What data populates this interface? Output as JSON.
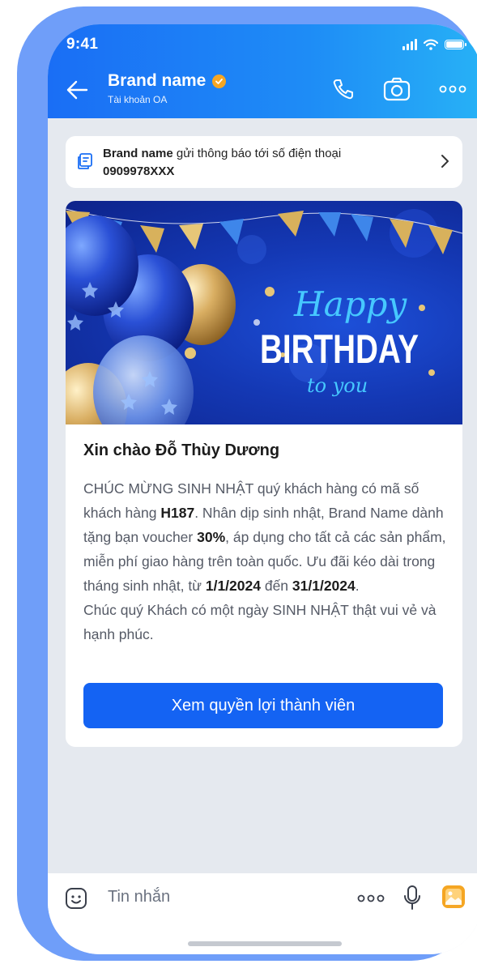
{
  "status_bar": {
    "time": "9:41"
  },
  "header": {
    "title": "Brand name",
    "subtitle": "Tài khoản OA"
  },
  "notice": {
    "brand": "Brand name",
    "text": " gửi thông báo tới số điện thoại",
    "phone": "0909978XXX"
  },
  "banner": {
    "script_top": "Happy",
    "headline": "BIRTHDAY",
    "script_bottom": "to you"
  },
  "message": {
    "greeting": "Xin chào Đỗ Thùy Dương",
    "p1": "CHÚC MỪNG SINH NHẬT quý khách hàng có mã số khách hàng ",
    "customer_code": "H187",
    "p2": ". Nhân dịp sinh nhật, Brand Name dành tặng bạn voucher ",
    "voucher": "30%",
    "p3": ", áp dụng cho tất cả các sản phẩm, miễn phí giao hàng trên toàn quốc. Ưu đãi kéo dài trong tháng sinh nhật, từ ",
    "date_from": "1/1/2024",
    "p4": " đến ",
    "date_to": "31/1/2024",
    "p5": ".",
    "closing": "Chúc quý Khách có một ngày SINH NHẬT thật vui vẻ và hạnh phúc.",
    "cta_label": "Xem quyền lợi thành viên"
  },
  "composer": {
    "placeholder": "Tin nhắn"
  },
  "colors": {
    "header_start": "#1a6ef5",
    "header_end": "#27b1f6",
    "cta": "#1463f3",
    "verified_badge": "#f5a623",
    "phone_frame": "#6f9ef9"
  },
  "icons": [
    "arrow-left-icon",
    "verified-icon",
    "phone-icon",
    "camera-icon",
    "more-icon",
    "notice-icon",
    "chevron-right-icon",
    "sticker-icon",
    "microphone-icon",
    "image-icon"
  ]
}
